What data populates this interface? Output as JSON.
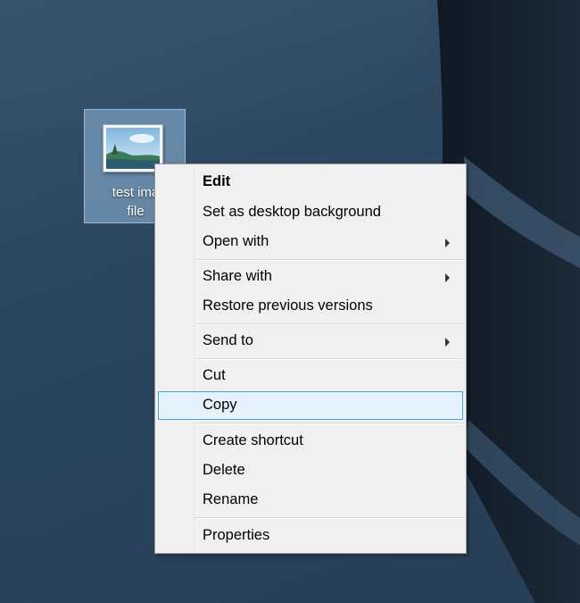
{
  "desktop": {
    "icon": {
      "label_line1": "test ima",
      "label_line2": "file",
      "thumbnail_icon": "image-file-icon"
    }
  },
  "context_menu": {
    "items": [
      {
        "label": "Edit",
        "bold": true,
        "submenu": false
      },
      {
        "label": "Set as desktop background",
        "bold": false,
        "submenu": false
      },
      {
        "label": "Open with",
        "bold": false,
        "submenu": true
      },
      {
        "label": "Share with",
        "bold": false,
        "submenu": true
      },
      {
        "label": "Restore previous versions",
        "bold": false,
        "submenu": false
      },
      {
        "label": "Send to",
        "bold": false,
        "submenu": true
      },
      {
        "label": "Cut",
        "bold": false,
        "submenu": false
      },
      {
        "label": "Copy",
        "bold": false,
        "submenu": false,
        "highlighted": true
      },
      {
        "label": "Create shortcut",
        "bold": false,
        "submenu": false
      },
      {
        "label": "Delete",
        "bold": false,
        "submenu": false
      },
      {
        "label": "Rename",
        "bold": false,
        "submenu": false
      },
      {
        "label": "Properties",
        "bold": false,
        "submenu": false
      }
    ],
    "highlight_color": "#e5f1fb",
    "highlight_border_color": "#4aa0d8"
  },
  "colors": {
    "desktop_background": "#2c4660",
    "menu_background": "#f0f0f0"
  }
}
